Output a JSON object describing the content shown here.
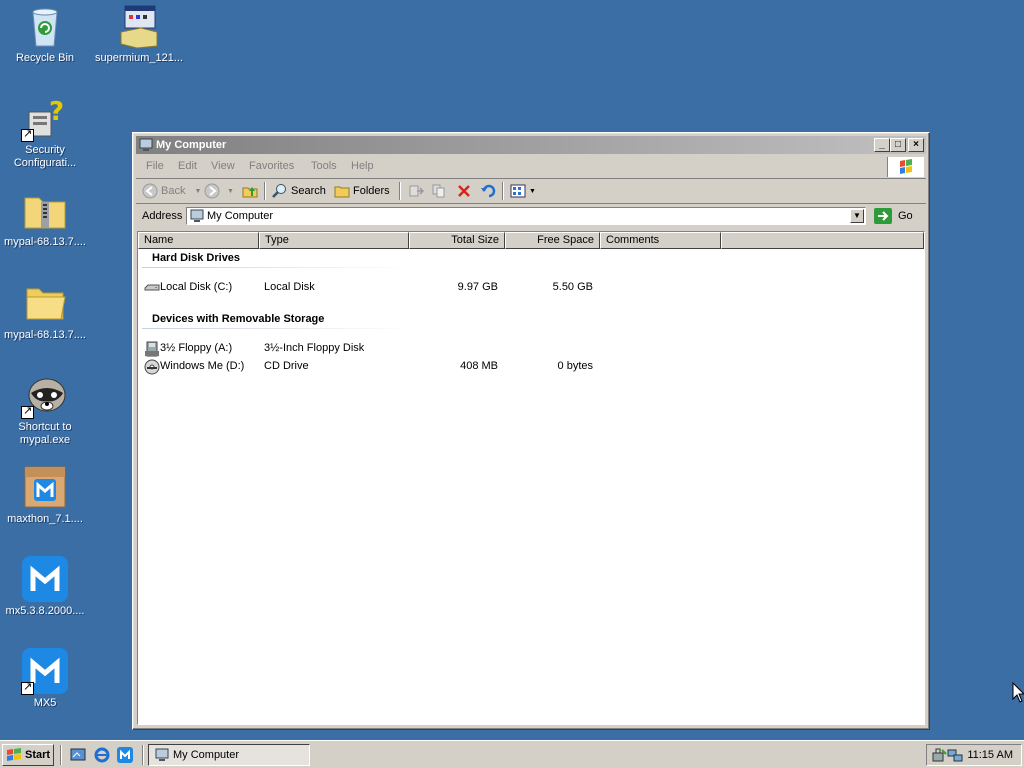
{
  "desktop": {
    "icons": [
      {
        "label": "Recycle Bin"
      },
      {
        "label": "supermium_121..."
      },
      {
        "label": "Security Configurati..."
      },
      {
        "label": "mypal-68.13.7...."
      },
      {
        "label": "mypal-68.13.7...."
      },
      {
        "label": "Shortcut to mypal.exe"
      },
      {
        "label": "maxthon_7.1...."
      },
      {
        "label": "mx5.3.8.2000...."
      },
      {
        "label": "MX5"
      }
    ]
  },
  "window": {
    "title": "My Computer",
    "menu": [
      "File",
      "Edit",
      "View",
      "Favorites",
      "Tools",
      "Help"
    ],
    "toolbar": {
      "back": "Back",
      "search": "Search",
      "folders": "Folders"
    },
    "address": {
      "label": "Address",
      "value": "My Computer",
      "go": "Go"
    },
    "columns": [
      "Name",
      "Type",
      "Total Size",
      "Free Space",
      "Comments"
    ],
    "groups": [
      {
        "title": "Hard Disk Drives",
        "items": [
          {
            "name": "Local Disk (C:)",
            "type": "Local Disk",
            "total": "9.97 GB",
            "free": "5.50 GB",
            "icon": "hard-disk-icon"
          }
        ]
      },
      {
        "title": "Devices with Removable Storage",
        "items": [
          {
            "name": "3½ Floppy (A:)",
            "type": "3½-Inch Floppy Disk",
            "total": "",
            "free": "",
            "icon": "floppy-icon"
          },
          {
            "name": "Windows Me (D:)",
            "type": "CD Drive",
            "total": "408 MB",
            "free": "0 bytes",
            "icon": "cd-drive-icon"
          }
        ]
      }
    ]
  },
  "taskbar": {
    "start": "Start",
    "task": "My Computer",
    "clock": "11:15 AM"
  },
  "colors": {
    "desktop": "#3a6ea5",
    "face": "#d4d0c8",
    "title_inactive": "#808080"
  }
}
